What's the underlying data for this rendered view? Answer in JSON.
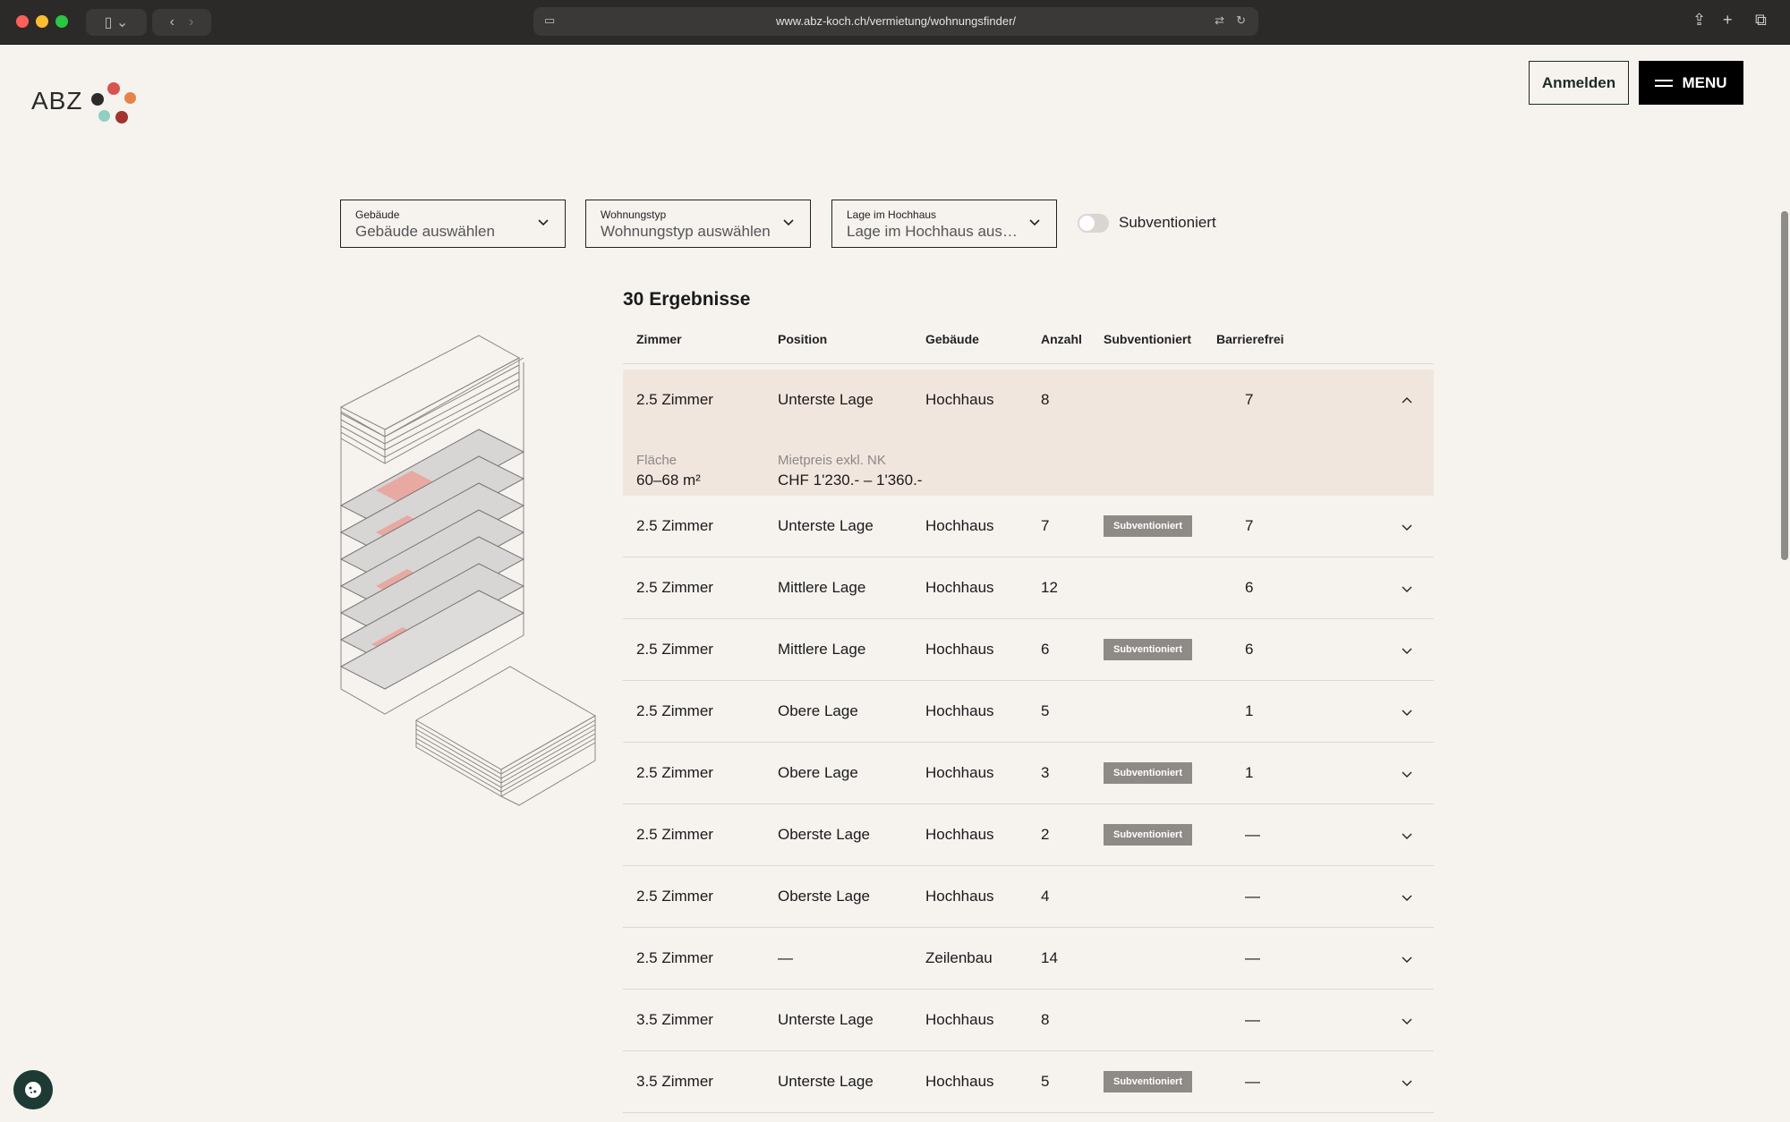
{
  "browser": {
    "url": "www.abz-koch.ch/vermietung/wohnungsfinder/"
  },
  "header": {
    "logo_text": "ABZ",
    "login_label": "Anmelden",
    "menu_label": "MENU"
  },
  "filters": {
    "building": {
      "label": "Gebäude",
      "placeholder": "Gebäude auswählen"
    },
    "type": {
      "label": "Wohnungstyp",
      "placeholder": "Wohnungstyp auswählen"
    },
    "position": {
      "label": "Lage im Hochhaus",
      "placeholder": "Lage im Hochhaus ausw..."
    },
    "subsidized_toggle_label": "Subventioniert",
    "subsidized_toggle_on": false
  },
  "results": {
    "count_label": "30 Ergebnisse",
    "columns": [
      "Zimmer",
      "Position",
      "Gebäude",
      "Anzahl",
      "Subventioniert",
      "Barrierefrei"
    ],
    "expanded_row": {
      "rooms": "2.5 Zimmer",
      "position": "Unterste Lage",
      "building": "Hochhaus",
      "count": "8",
      "subsidized": "",
      "accessible": "7",
      "area_label": "Fläche",
      "area_value": "60–68 m²",
      "rent_label": "Mietpreis exkl. NK",
      "rent_value": "CHF 1'230.- – 1'360.-"
    },
    "rows": [
      {
        "rooms": "2.5 Zimmer",
        "position": "Unterste Lage",
        "building": "Hochhaus",
        "count": "7",
        "subsidized": "Subventioniert",
        "accessible": "7"
      },
      {
        "rooms": "2.5 Zimmer",
        "position": "Mittlere Lage",
        "building": "Hochhaus",
        "count": "12",
        "subsidized": "",
        "accessible": "6"
      },
      {
        "rooms": "2.5 Zimmer",
        "position": "Mittlere Lage",
        "building": "Hochhaus",
        "count": "6",
        "subsidized": "Subventioniert",
        "accessible": "6"
      },
      {
        "rooms": "2.5 Zimmer",
        "position": "Obere Lage",
        "building": "Hochhaus",
        "count": "5",
        "subsidized": "",
        "accessible": "1"
      },
      {
        "rooms": "2.5 Zimmer",
        "position": "Obere Lage",
        "building": "Hochhaus",
        "count": "3",
        "subsidized": "Subventioniert",
        "accessible": "1"
      },
      {
        "rooms": "2.5 Zimmer",
        "position": "Oberste Lage",
        "building": "Hochhaus",
        "count": "2",
        "subsidized": "Subventioniert",
        "accessible": "—"
      },
      {
        "rooms": "2.5 Zimmer",
        "position": "Oberste Lage",
        "building": "Hochhaus",
        "count": "4",
        "subsidized": "",
        "accessible": "—"
      },
      {
        "rooms": "2.5 Zimmer",
        "position": "—",
        "building": "Zeilenbau",
        "count": "14",
        "subsidized": "",
        "accessible": "—"
      },
      {
        "rooms": "3.5 Zimmer",
        "position": "Unterste Lage",
        "building": "Hochhaus",
        "count": "8",
        "subsidized": "",
        "accessible": "—"
      },
      {
        "rooms": "3.5 Zimmer",
        "position": "Unterste Lage",
        "building": "Hochhaus",
        "count": "5",
        "subsidized": "Subventioniert",
        "accessible": "—"
      }
    ]
  },
  "colors": {
    "page_bg": "#f6f3ef",
    "expanded_row_bg": "#f1e6de",
    "badge_bg": "#8e8a86",
    "highlight_red": "#d9534f"
  }
}
